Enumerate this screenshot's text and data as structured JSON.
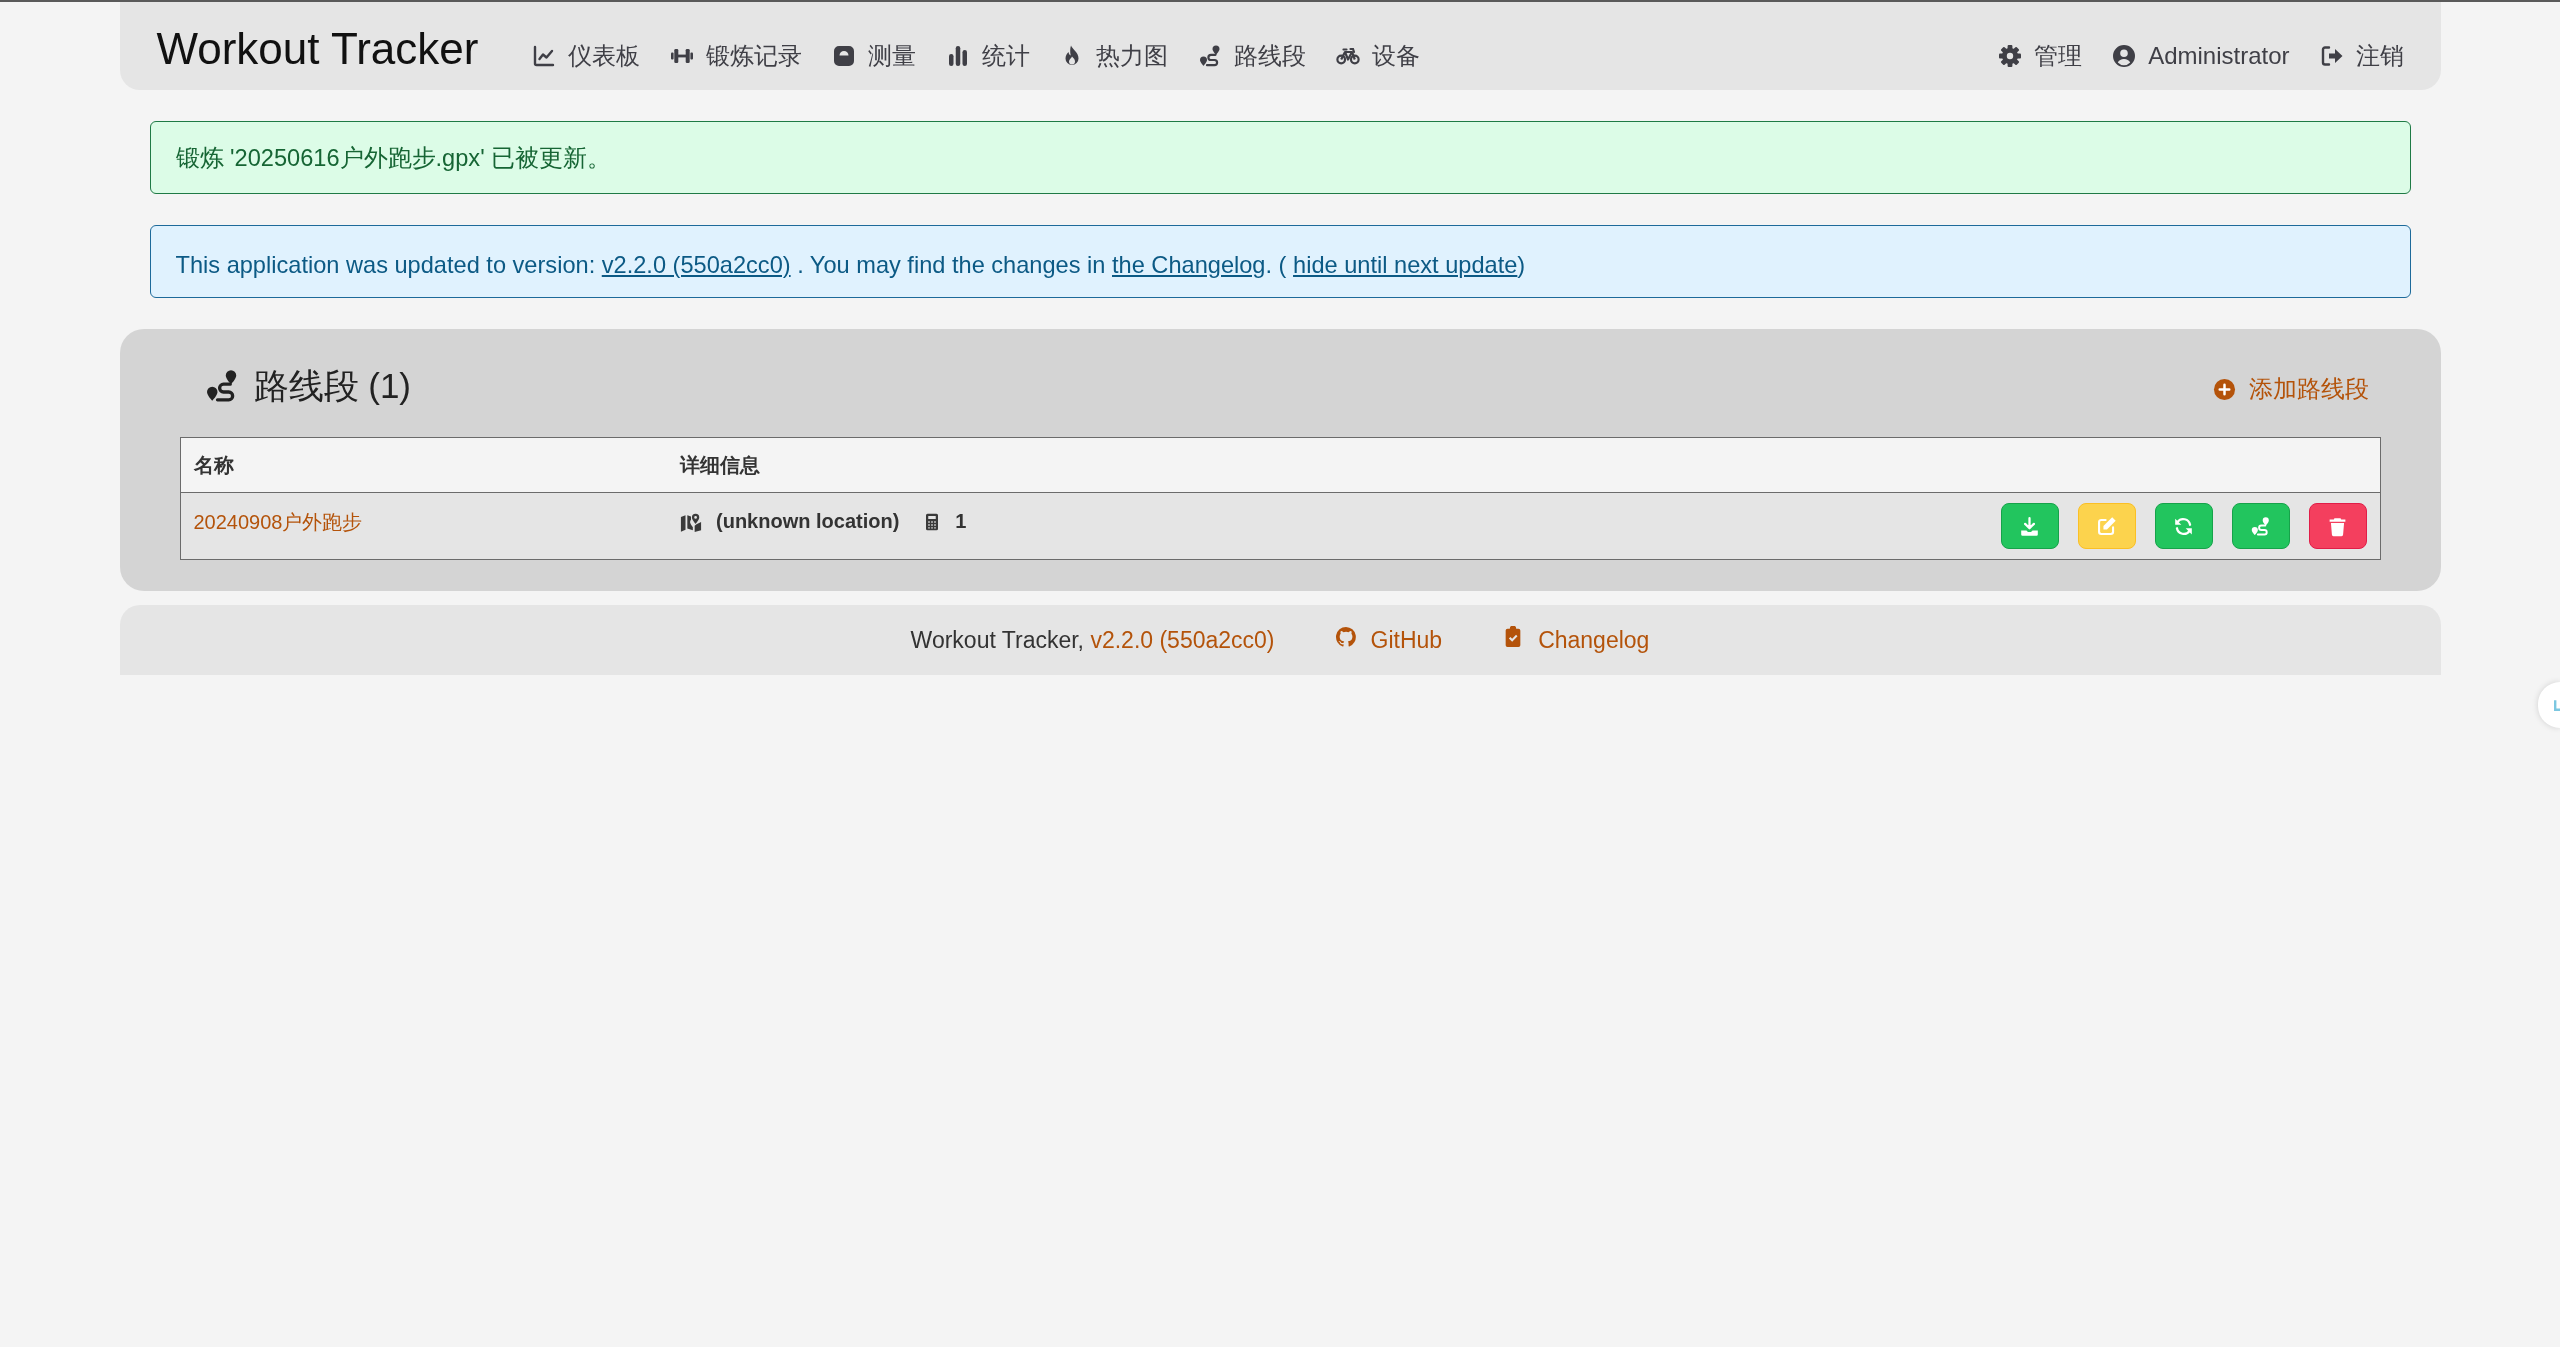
{
  "navbar": {
    "brand": "Workout Tracker",
    "menu": [
      "仪表板",
      "锻炼记录",
      "测量",
      "统计",
      "热力图",
      "路线段",
      "设备"
    ],
    "user_menu": [
      "管理",
      "Administrator",
      "注销"
    ]
  },
  "alerts": [
    {
      "kind": "success",
      "parts": [
        {
          "kind": "text",
          "text": "锻炼 '20250616户外跑步.gpx' 已被更新。"
        }
      ]
    },
    {
      "kind": "info",
      "parts": [
        {
          "kind": "text",
          "text": "This application was updated to version: "
        },
        {
          "kind": "link",
          "text": "v2.2.0 (550a2cc0)"
        },
        {
          "kind": "text",
          "text": " . You may find the changes in "
        },
        {
          "kind": "link",
          "text": "the Changelog"
        },
        {
          "kind": "text",
          "text": ". ( "
        },
        {
          "kind": "link",
          "text": "hide until next update"
        },
        {
          "kind": "text",
          "text": ")"
        }
      ]
    }
  ],
  "segments": {
    "title": "路线段 (1)",
    "add_link": "添加路线段",
    "table": {
      "columns": [
        "名称",
        "详细信息"
      ],
      "rows": [
        {
          "name": "20240908户外跑步",
          "location": "(unknown location)",
          "count": "1",
          "actions": [
            {
              "kind": "download"
            },
            {
              "kind": "edit"
            },
            {
              "kind": "refresh"
            },
            {
              "kind": "route"
            },
            {
              "kind": "delete"
            }
          ]
        }
      ]
    }
  },
  "footer": {
    "app_name": "Workout Tracker,",
    "version": "v2.2.0 (550a2cc0)",
    "links": [
      "GitHub",
      "Changelog"
    ]
  }
}
